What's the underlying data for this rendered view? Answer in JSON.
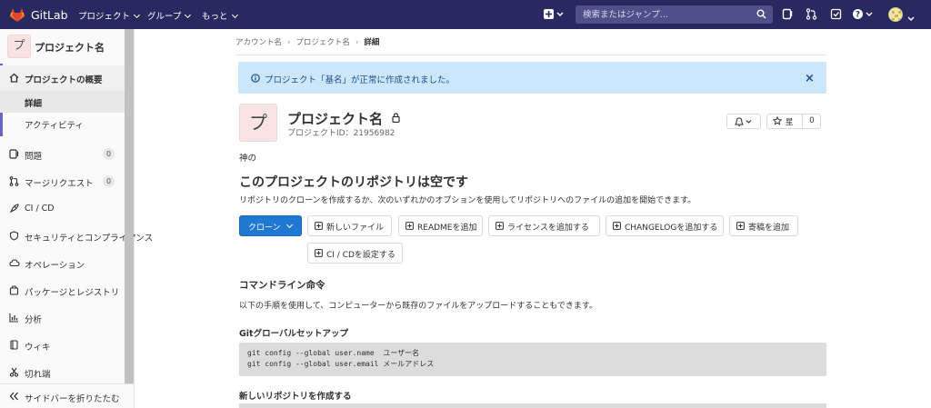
{
  "topbar": {
    "brand": "GitLab",
    "menus": [
      "プロジェクト",
      "グループ",
      "もっと"
    ],
    "search_placeholder": "検索またはジャンプ...",
    "colors": {
      "bg": "#292961",
      "search_bg": "#4f4f8a"
    }
  },
  "sidebar": {
    "project_initial": "プ",
    "project_name": "プロジェクト名",
    "overview": {
      "label": "プロジェクトの概要",
      "sub": [
        {
          "label": "詳細",
          "selected": true
        },
        {
          "label": "アクティビティ",
          "selected": false
        }
      ]
    },
    "items": [
      {
        "label": "問題",
        "icon": "issues-icon",
        "count": "0"
      },
      {
        "label": "マージリクエスト",
        "icon": "merge-request-icon",
        "count": "0"
      },
      {
        "label": "CI / CD",
        "icon": "rocket-icon",
        "count": null
      },
      {
        "label": "セキュリティとコンプライアンス",
        "icon": "shield-icon",
        "count": null
      },
      {
        "label": "オペレーション",
        "icon": "cloud-icon",
        "count": null
      },
      {
        "label": "パッケージとレジストリ",
        "icon": "package-icon",
        "count": null
      },
      {
        "label": "分析",
        "icon": "chart-icon",
        "count": null
      },
      {
        "label": "ウィキ",
        "icon": "book-icon",
        "count": null
      },
      {
        "label": "切れ端",
        "icon": "scissors-icon",
        "count": null
      }
    ],
    "collapse_label": "サイドバーを折りたたむ"
  },
  "breadcrumb": [
    "アカウント名",
    "プロジェクト名",
    "詳細"
  ],
  "alert": {
    "message": "プロジェクト「基名」が正常に作成されました。",
    "close": "×"
  },
  "project": {
    "initial": "プ",
    "name": "プロジェクト名",
    "id_text": "プロジェクトID：21956982",
    "star_label": "星",
    "star_count": "0",
    "description": "神の"
  },
  "empty": {
    "title": "このプロジェクトのリポジトリは空です",
    "text": "リポジトリのクローンを作成するか、次のいずれかのオプションを使用してリポジトリへのファイルの追加を開始できます。"
  },
  "buttons": {
    "clone": "クローン",
    "new_file": "新しいファイル",
    "add_readme": "READMEを追加",
    "add_license": "ライセンスを追加する",
    "add_changelog": "CHANGELOGを追加する",
    "add_contrib": "寄稿を追加",
    "setup_ci": "CI / CDを設定する"
  },
  "cli": {
    "title": "コマンドライン命令",
    "text": "以下の手順を使用して、コンピューターから既存のファイルをアップロードすることもできます。",
    "global_setup_title": "Gitグローバルセットアップ",
    "global_setup_code": [
      "git config --global user.name  ユーザー名",
      "git config --global user.email メールアドレス"
    ],
    "new_repo_title": "新しいリポジトリを作成する"
  }
}
